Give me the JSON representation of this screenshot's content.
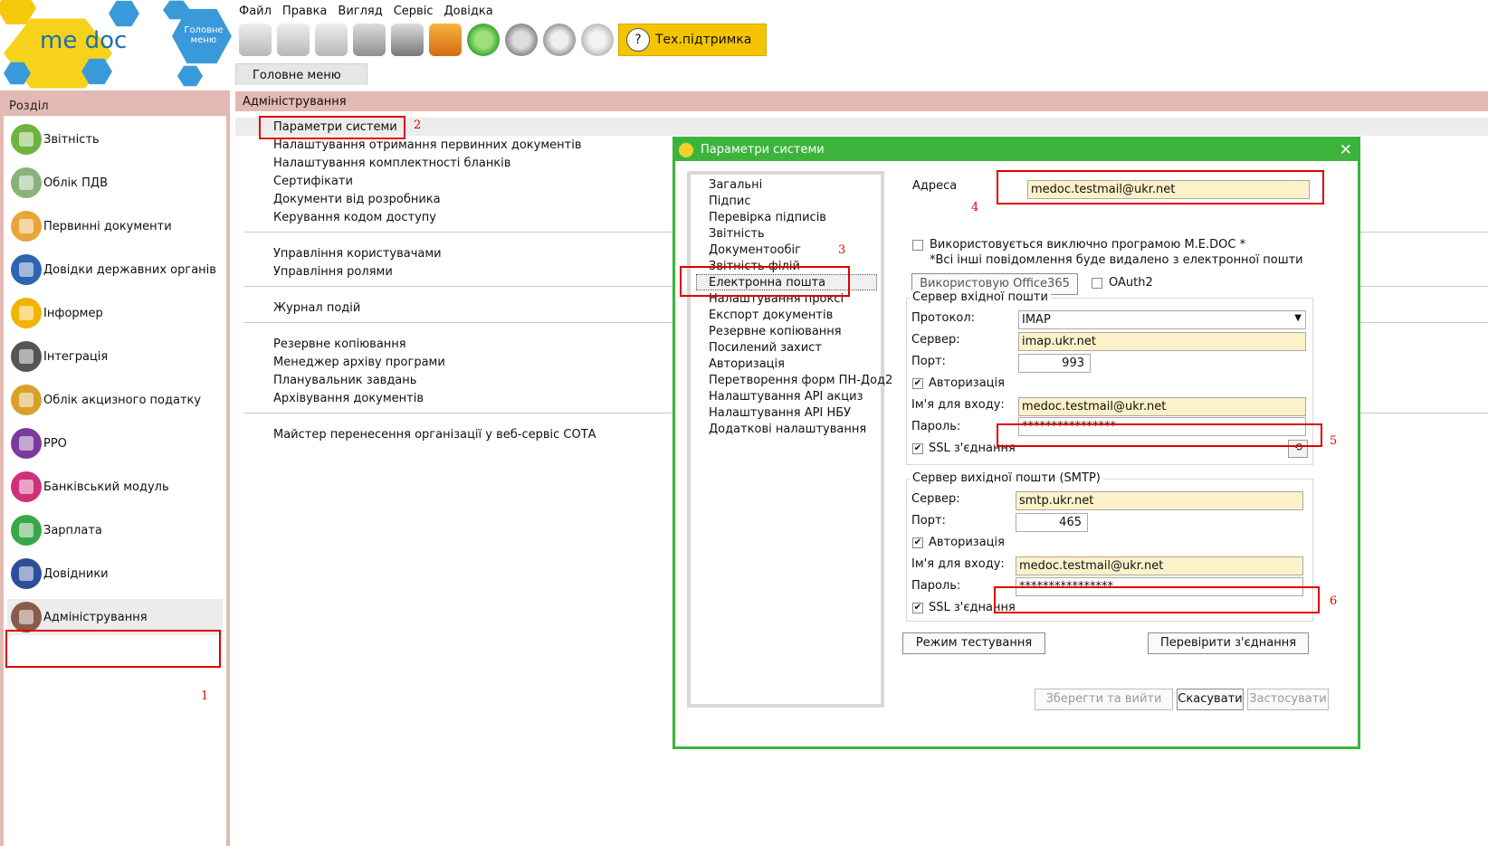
{
  "logo": {
    "brand": "me doc",
    "main_menu_icon": "Головне меню"
  },
  "menu": [
    "Файл",
    "Правка",
    "Вигляд",
    "Сервіс",
    "Довідка"
  ],
  "toolbar": {
    "icons": [
      "open-icon",
      "delete-icon",
      "copy-icon",
      "save-icon",
      "print-icon",
      "send-icon",
      "receive-icon",
      "search-icon",
      "message-icon",
      "sign-icon"
    ],
    "support_label": "Тех.підтримка"
  },
  "tabs": {
    "main": "Головне меню"
  },
  "sidebar": {
    "title": "Розділ",
    "items": [
      {
        "label": "Звітність",
        "color": "#6fb33f"
      },
      {
        "label": "Облік ПДВ",
        "color": "#8bb17a"
      },
      {
        "label": "Первинні документи",
        "color": "#e8a63a"
      },
      {
        "label": "Довідки державних органів",
        "color": "#2f64b0"
      },
      {
        "label": "Інформер",
        "color": "#f0b400"
      },
      {
        "label": "Інтеграція",
        "color": "#555555"
      },
      {
        "label": "Облік акцизного податку",
        "color": "#d8a12a"
      },
      {
        "label": "РРО",
        "color": "#7a3b9a"
      },
      {
        "label": "Банківський модуль",
        "color": "#d0307a"
      },
      {
        "label": "Зарплата",
        "color": "#3aa64a"
      },
      {
        "label": "Довідники",
        "color": "#2d4f9b"
      },
      {
        "label": "Адміністрування",
        "color": "#8a5a4a"
      }
    ]
  },
  "admin": {
    "title": "Адміністрування",
    "items": [
      "Параметри системи",
      "Налаштування отримання первинних документів",
      "Налаштування комплектності бланків",
      "Сертифікати",
      "Документи від розробника",
      "Керування кодом доступу",
      "Управління користувачами",
      "Управління ролями",
      "Журнал подій",
      "Резервне копіювання",
      "Менеджер архіву програми",
      "Планувальник завдань",
      "Архівування документів",
      "Майстер перенесення організації у веб-сервіс СОТА"
    ]
  },
  "dialog": {
    "title": "Параметри системи",
    "tree": [
      "Загальні",
      "Підпис",
      "Перевірка підписів",
      "Звітність",
      "Документообіг",
      "Звітність філій",
      "Електронна пошта",
      "Налаштування проксі",
      "Експорт документів",
      "Резервне копіювання",
      "Посилений захист",
      "Авторизація",
      "Перетворення форм ПН-Дод2",
      "Налаштування API акциз",
      "Налаштування API НБУ",
      "Додаткові налаштування"
    ],
    "address_label": "Адреса",
    "address_value": "medoc.testmail@ukr.net",
    "exclusive_label": "Використовується виключно програмою M.E.DOC *",
    "exclusive_note": "*Всі інші повідомлення буде видалено з електронної пошти",
    "office365_btn": "Використовую Office365",
    "oauth_label": "OAuth2",
    "incoming": {
      "title": "Сервер вхідної пошти",
      "protocol_label": "Протокол:",
      "protocol_value": "IMAP",
      "server_label": "Сервер:",
      "server_value": "imap.ukr.net",
      "port_label": "Порт:",
      "port_value": "993",
      "auth_label": "Авторизація",
      "login_label": "Ім'я для входу:",
      "login_value": "medoc.testmail@ukr.net",
      "password_label": "Пароль:",
      "password_value": "****************",
      "ssl_label": "SSL з'єднання"
    },
    "outgoing": {
      "title": "Сервер вихідної пошти (SMTP)",
      "server_label": "Сервер:",
      "server_value": "smtp.ukr.net",
      "port_label": "Порт:",
      "port_value": "465",
      "auth_label": "Авторизація",
      "login_label": "Ім'я для входу:",
      "login_value": "medoc.testmail@ukr.net",
      "password_label": "Пароль:",
      "password_value": "****************",
      "ssl_label": "SSL з'єднання"
    },
    "test_mode_btn": "Режим тестування",
    "check_conn_btn": "Перевірити з'єднання",
    "save_exit_btn": "Зберегти та вийти",
    "cancel_btn": "Скасувати",
    "apply_btn": "Застосувати"
  },
  "annotations": [
    "1",
    "2",
    "3",
    "4",
    "5",
    "6"
  ],
  "colors": {
    "accent_green": "#3cb43c",
    "section_pink": "#e3b9b3",
    "highlight_red": "#e00000",
    "field_yellow": "#fdf1c9",
    "support_yellow": "#f5c400"
  }
}
